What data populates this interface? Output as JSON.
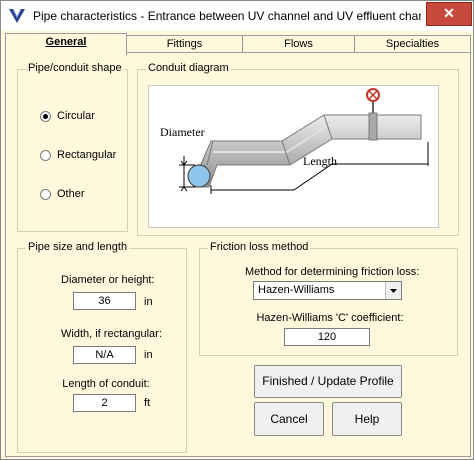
{
  "window": {
    "title": "Pipe characteristics - Entrance between UV channel and UV effluent chan...",
    "app_icon": "v-logo-icon",
    "close_glyph": "✕"
  },
  "tabs": [
    {
      "label": "General",
      "active": true
    },
    {
      "label": "Fittings",
      "active": false
    },
    {
      "label": "Flows",
      "active": false
    },
    {
      "label": "Specialties",
      "active": false
    }
  ],
  "shape_group": {
    "title": "Pipe/conduit shape",
    "options": [
      {
        "label": "Circular",
        "checked": true
      },
      {
        "label": "Rectangular",
        "checked": false
      },
      {
        "label": "Other",
        "checked": false
      }
    ]
  },
  "diagram_group": {
    "title": "Conduit diagram",
    "diameter_label": "Diameter",
    "length_label": "Length"
  },
  "size_group": {
    "title": "Pipe size and length",
    "diameter": {
      "label": "Diameter or height:",
      "value": "36",
      "unit": "in"
    },
    "width": {
      "label": "Width, if rectangular:",
      "value": "N/A",
      "unit": "in"
    },
    "length": {
      "label": "Length of conduit:",
      "value": "2",
      "unit": "ft"
    }
  },
  "friction_group": {
    "title": "Friction loss method",
    "method_label": "Method for determining friction loss:",
    "method_value": "Hazen-Williams",
    "coef_label": "Hazen-Williams 'C' coefficient:",
    "coef_value": "120"
  },
  "buttons": {
    "finished": "Finished / Update Profile",
    "cancel": "Cancel",
    "help": "Help"
  }
}
